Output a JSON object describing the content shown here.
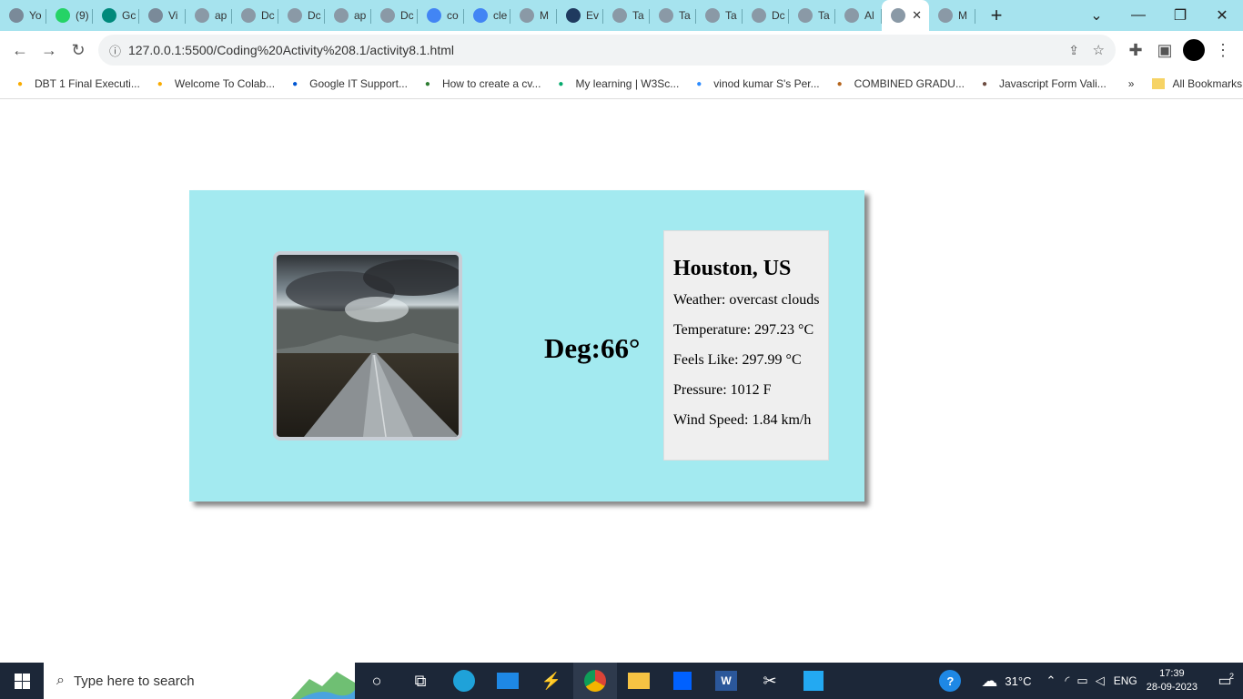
{
  "browser": {
    "tabs": [
      {
        "label": "Yo",
        "icon": "github-icon",
        "color": "#7a8a99"
      },
      {
        "label": "(9)",
        "icon": "whatsapp-icon",
        "color": "#25d366"
      },
      {
        "label": "Gc",
        "icon": "google-meet-icon",
        "color": "#00897b"
      },
      {
        "label": "Vi",
        "icon": "github-icon",
        "color": "#7a8a99"
      },
      {
        "label": "ap",
        "icon": "globe-icon",
        "color": "#8a99a6"
      },
      {
        "label": "Dc",
        "icon": "globe-icon",
        "color": "#8a99a6"
      },
      {
        "label": "Dc",
        "icon": "globe-icon",
        "color": "#8a99a6"
      },
      {
        "label": "ap",
        "icon": "globe-icon",
        "color": "#8a99a6"
      },
      {
        "label": "Dc",
        "icon": "globe-icon",
        "color": "#8a99a6"
      },
      {
        "label": "co",
        "icon": "google-icon",
        "color": "#4285f4"
      },
      {
        "label": "cle",
        "icon": "google-icon",
        "color": "#4285f4"
      },
      {
        "label": "M",
        "icon": "globe-icon",
        "color": "#8a99a6"
      },
      {
        "label": "Ev",
        "icon": "sf-icon",
        "color": "#1f3a5f"
      },
      {
        "label": "Ta",
        "icon": "globe-icon",
        "color": "#8a99a6"
      },
      {
        "label": "Ta",
        "icon": "globe-icon",
        "color": "#8a99a6"
      },
      {
        "label": "Ta",
        "icon": "globe-icon",
        "color": "#8a99a6"
      },
      {
        "label": "Dc",
        "icon": "globe-icon",
        "color": "#8a99a6"
      },
      {
        "label": "Ta",
        "icon": "globe-icon",
        "color": "#8a99a6"
      },
      {
        "label": "Al",
        "icon": "globe-icon",
        "color": "#8a99a6"
      }
    ],
    "active_tab": {
      "label": "",
      "icon": "globe-icon",
      "close": "✕"
    },
    "after_tab": {
      "label": "M",
      "icon": "globe-icon"
    },
    "new_tab": "+",
    "url": "127.0.0.1:5500/Coding%20Activity%208.1/activity8.1.html",
    "bookmarks": [
      {
        "label": "DBT 1 Final Executi...",
        "icon": "colab-icon",
        "color": "#f9ab00"
      },
      {
        "label": "Welcome To Colab...",
        "icon": "colab-icon",
        "color": "#f9ab00"
      },
      {
        "label": "Google IT Support...",
        "icon": "coursera-icon",
        "color": "#0056d2"
      },
      {
        "label": "How to create a cv...",
        "icon": "link-icon",
        "color": "#2e7d32"
      },
      {
        "label": "My learning | W3Sc...",
        "icon": "w3schools-icon",
        "color": "#04aa6d"
      },
      {
        "label": "vinod kumar S's Per...",
        "icon": "zoom-icon",
        "color": "#2d8cff"
      },
      {
        "label": "COMBINED GRADU...",
        "icon": "emblem-icon",
        "color": "#b5651d"
      },
      {
        "label": "Javascript Form Vali...",
        "icon": "avatar-icon",
        "color": "#6d4c41"
      }
    ],
    "more_bookmarks": "»",
    "all_bookmarks": "All Bookmarks"
  },
  "weather": {
    "degree": "Deg:66°",
    "city": "Houston, US",
    "weather_line": "Weather: overcast clouds",
    "temperature_line": "Temperature: 297.23 °C",
    "feels_like_line": "Feels Like: 297.99 °C",
    "pressure_line": "Pressure: 1012 F",
    "wind_line": "Wind Speed: 1.84 km/h"
  },
  "taskbar": {
    "search_placeholder": "Type here to search",
    "temperature": "31°C",
    "language": "ENG",
    "time": "17:39",
    "date": "28-09-2023",
    "notifications": "2"
  }
}
